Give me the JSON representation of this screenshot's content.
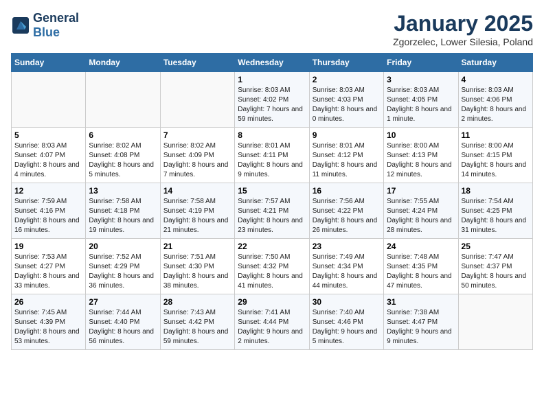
{
  "header": {
    "logo_line1": "General",
    "logo_line2": "Blue",
    "title": "January 2025",
    "subtitle": "Zgorzelec, Lower Silesia, Poland"
  },
  "weekdays": [
    "Sunday",
    "Monday",
    "Tuesday",
    "Wednesday",
    "Thursday",
    "Friday",
    "Saturday"
  ],
  "weeks": [
    [
      {
        "day": "",
        "info": ""
      },
      {
        "day": "",
        "info": ""
      },
      {
        "day": "",
        "info": ""
      },
      {
        "day": "1",
        "info": "Sunrise: 8:03 AM\nSunset: 4:02 PM\nDaylight: 7 hours and 59 minutes."
      },
      {
        "day": "2",
        "info": "Sunrise: 8:03 AM\nSunset: 4:03 PM\nDaylight: 8 hours and 0 minutes."
      },
      {
        "day": "3",
        "info": "Sunrise: 8:03 AM\nSunset: 4:05 PM\nDaylight: 8 hours and 1 minute."
      },
      {
        "day": "4",
        "info": "Sunrise: 8:03 AM\nSunset: 4:06 PM\nDaylight: 8 hours and 2 minutes."
      }
    ],
    [
      {
        "day": "5",
        "info": "Sunrise: 8:03 AM\nSunset: 4:07 PM\nDaylight: 8 hours and 4 minutes."
      },
      {
        "day": "6",
        "info": "Sunrise: 8:02 AM\nSunset: 4:08 PM\nDaylight: 8 hours and 5 minutes."
      },
      {
        "day": "7",
        "info": "Sunrise: 8:02 AM\nSunset: 4:09 PM\nDaylight: 8 hours and 7 minutes."
      },
      {
        "day": "8",
        "info": "Sunrise: 8:01 AM\nSunset: 4:11 PM\nDaylight: 8 hours and 9 minutes."
      },
      {
        "day": "9",
        "info": "Sunrise: 8:01 AM\nSunset: 4:12 PM\nDaylight: 8 hours and 11 minutes."
      },
      {
        "day": "10",
        "info": "Sunrise: 8:00 AM\nSunset: 4:13 PM\nDaylight: 8 hours and 12 minutes."
      },
      {
        "day": "11",
        "info": "Sunrise: 8:00 AM\nSunset: 4:15 PM\nDaylight: 8 hours and 14 minutes."
      }
    ],
    [
      {
        "day": "12",
        "info": "Sunrise: 7:59 AM\nSunset: 4:16 PM\nDaylight: 8 hours and 16 minutes."
      },
      {
        "day": "13",
        "info": "Sunrise: 7:58 AM\nSunset: 4:18 PM\nDaylight: 8 hours and 19 minutes."
      },
      {
        "day": "14",
        "info": "Sunrise: 7:58 AM\nSunset: 4:19 PM\nDaylight: 8 hours and 21 minutes."
      },
      {
        "day": "15",
        "info": "Sunrise: 7:57 AM\nSunset: 4:21 PM\nDaylight: 8 hours and 23 minutes."
      },
      {
        "day": "16",
        "info": "Sunrise: 7:56 AM\nSunset: 4:22 PM\nDaylight: 8 hours and 26 minutes."
      },
      {
        "day": "17",
        "info": "Sunrise: 7:55 AM\nSunset: 4:24 PM\nDaylight: 8 hours and 28 minutes."
      },
      {
        "day": "18",
        "info": "Sunrise: 7:54 AM\nSunset: 4:25 PM\nDaylight: 8 hours and 31 minutes."
      }
    ],
    [
      {
        "day": "19",
        "info": "Sunrise: 7:53 AM\nSunset: 4:27 PM\nDaylight: 8 hours and 33 minutes."
      },
      {
        "day": "20",
        "info": "Sunrise: 7:52 AM\nSunset: 4:29 PM\nDaylight: 8 hours and 36 minutes."
      },
      {
        "day": "21",
        "info": "Sunrise: 7:51 AM\nSunset: 4:30 PM\nDaylight: 8 hours and 38 minutes."
      },
      {
        "day": "22",
        "info": "Sunrise: 7:50 AM\nSunset: 4:32 PM\nDaylight: 8 hours and 41 minutes."
      },
      {
        "day": "23",
        "info": "Sunrise: 7:49 AM\nSunset: 4:34 PM\nDaylight: 8 hours and 44 minutes."
      },
      {
        "day": "24",
        "info": "Sunrise: 7:48 AM\nSunset: 4:35 PM\nDaylight: 8 hours and 47 minutes."
      },
      {
        "day": "25",
        "info": "Sunrise: 7:47 AM\nSunset: 4:37 PM\nDaylight: 8 hours and 50 minutes."
      }
    ],
    [
      {
        "day": "26",
        "info": "Sunrise: 7:45 AM\nSunset: 4:39 PM\nDaylight: 8 hours and 53 minutes."
      },
      {
        "day": "27",
        "info": "Sunrise: 7:44 AM\nSunset: 4:40 PM\nDaylight: 8 hours and 56 minutes."
      },
      {
        "day": "28",
        "info": "Sunrise: 7:43 AM\nSunset: 4:42 PM\nDaylight: 8 hours and 59 minutes."
      },
      {
        "day": "29",
        "info": "Sunrise: 7:41 AM\nSunset: 4:44 PM\nDaylight: 9 hours and 2 minutes."
      },
      {
        "day": "30",
        "info": "Sunrise: 7:40 AM\nSunset: 4:46 PM\nDaylight: 9 hours and 5 minutes."
      },
      {
        "day": "31",
        "info": "Sunrise: 7:38 AM\nSunset: 4:47 PM\nDaylight: 9 hours and 9 minutes."
      },
      {
        "day": "",
        "info": ""
      }
    ]
  ]
}
